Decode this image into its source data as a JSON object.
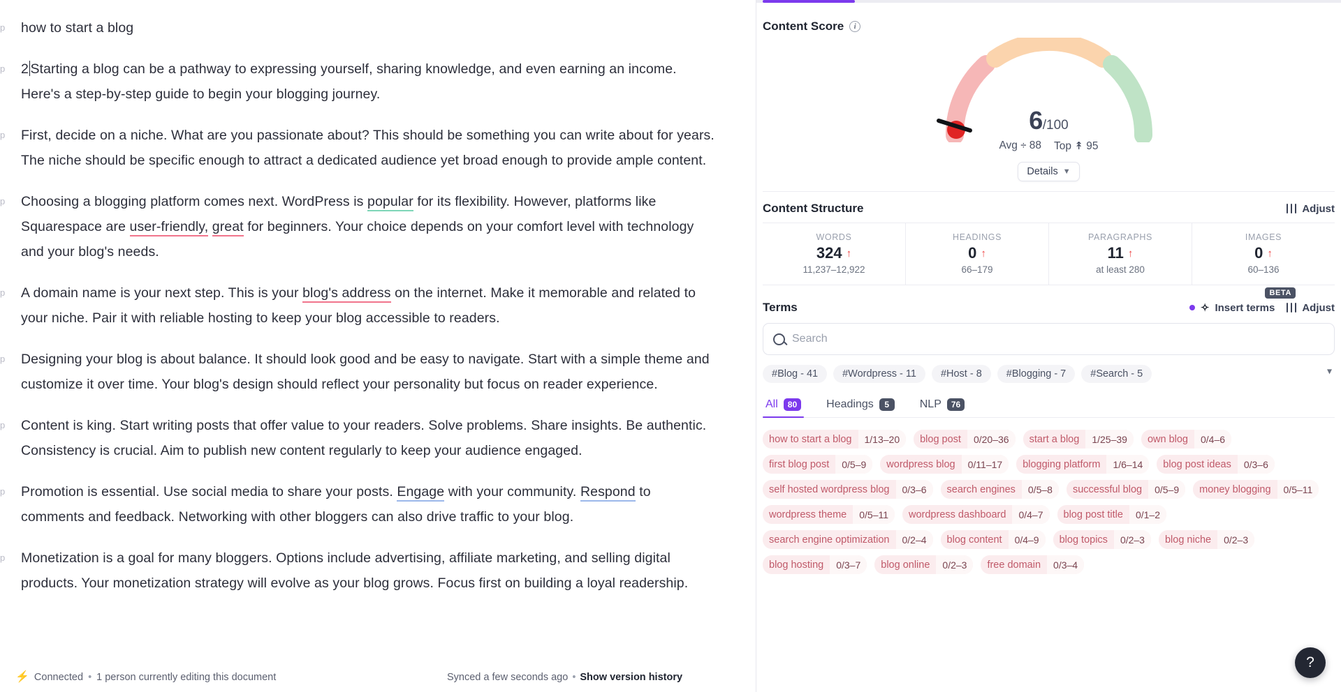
{
  "editor": {
    "paragraph_tag": "p",
    "paragraphs": [
      {
        "tag": "p",
        "text": "how to start a blog"
      },
      {
        "tag": "p",
        "text": "2Starting a blog can be a pathway to expressing yourself, sharing knowledge, and even earning an income. Here's a step-by-step guide to begin your blogging journey."
      },
      {
        "tag": "p",
        "text": "First, decide on a niche. What are you passionate about? This should be something you can write about for years. The niche should be specific enough to attract a dedicated audience yet broad enough to provide ample content."
      },
      {
        "tag": "p",
        "text": "Choosing a blogging platform comes next. WordPress is popular for its flexibility. However, platforms like Squarespace are user-friendly, great for beginners. Your choice depends on your comfort level with technology and your blog's needs."
      },
      {
        "tag": "p",
        "text": "A domain name is your next step. This is your blog's address on the internet. Make it memorable and related to your niche. Pair it with reliable hosting to keep your blog accessible to readers."
      },
      {
        "tag": "p",
        "text": "Designing your blog is about balance. It should look good and be easy to navigate. Start with a simple theme and customize it over time. Your blog's design should reflect your personality but focus on reader experience."
      },
      {
        "tag": "p",
        "text": "Content is king. Start writing posts that offer value to your readers. Solve problems. Share insights. Be authentic. Consistency is crucial. Aim to publish new content regularly to keep your audience engaged."
      },
      {
        "tag": "p",
        "text": "Promotion is essential. Use social media to share your posts. Engage with your community. Respond to comments and feedback. Networking with other bloggers can also drive traffic to your blog."
      },
      {
        "tag": "p",
        "text": "Monetization is a goal for many bloggers. Options include advertising, affiliate marketing, and selling digital products. Your monetization strategy will evolve as your blog grows. Focus first on building a loyal readership."
      }
    ],
    "highlights": {
      "popular": "#7fd6b8",
      "user-friendly,": "#f1748c",
      "great": "#f1748c",
      "blog's address": "#f1748c",
      "Engage": "#9cb8ea",
      "Respond": "#9cb8ea"
    }
  },
  "status_bar": {
    "bolt_icon": "bolt-icon",
    "connection": "Connected",
    "separator": "•",
    "editors": "1 person currently editing this document",
    "synced": "Synced a few seconds ago",
    "version_link": "Show version history"
  },
  "content_score": {
    "title": "Content Score",
    "info_icon": "info-icon",
    "score": "6",
    "denominator": "/100",
    "avg_label": "Avg",
    "avg_icon": "divide-icon",
    "avg_value": "88",
    "top_label": "Top",
    "top_icon": "up-arrow-bar-icon",
    "top_value": "95",
    "details_label": "Details",
    "details_chevron": "chevron-down-icon"
  },
  "content_structure": {
    "title": "Content Structure",
    "adjust_label": "Adjust",
    "adjust_icon": "sliders-icon",
    "stats": [
      {
        "key": "WORDS",
        "value": "324",
        "trend": "↑",
        "range": "11,237–12,922"
      },
      {
        "key": "HEADINGS",
        "value": "0",
        "trend": "↑",
        "range": "66–179"
      },
      {
        "key": "PARAGRAPHS",
        "value": "11",
        "trend": "↑",
        "range": "at least 280"
      },
      {
        "key": "IMAGES",
        "value": "0",
        "trend": "↑",
        "range": "60–136"
      }
    ]
  },
  "terms": {
    "title": "Terms",
    "beta_badge": "BETA",
    "insert_terms_label": "Insert terms",
    "insert_icon": "sparkle-icon",
    "adjust_label": "Adjust",
    "adjust_icon": "sliders-icon",
    "search_placeholder": "Search",
    "search_value": "",
    "search_icon": "search-icon",
    "expand_chevron": "chevron-down-icon",
    "hashtags": [
      "#Blog - 41",
      "#Wordpress - 11",
      "#Host - 8",
      "#Blogging - 7",
      "#Search - 5"
    ],
    "tabs": [
      {
        "label": "All",
        "count": "80",
        "active": true
      },
      {
        "label": "Headings",
        "count": "5",
        "active": false
      },
      {
        "label": "NLP",
        "count": "76",
        "active": false
      }
    ],
    "items": [
      {
        "name": "how to start a blog",
        "count": "1/13–20"
      },
      {
        "name": "blog post",
        "count": "0/20–36"
      },
      {
        "name": "start a blog",
        "count": "1/25–39"
      },
      {
        "name": "own blog",
        "count": "0/4–6"
      },
      {
        "name": "first blog post",
        "count": "0/5–9"
      },
      {
        "name": "wordpress blog",
        "count": "0/11–17"
      },
      {
        "name": "blogging platform",
        "count": "1/6–14"
      },
      {
        "name": "blog post ideas",
        "count": "0/3–6"
      },
      {
        "name": "self hosted wordpress blog",
        "count": "0/3–6"
      },
      {
        "name": "search engines",
        "count": "0/5–8"
      },
      {
        "name": "successful blog",
        "count": "0/5–9"
      },
      {
        "name": "money blogging",
        "count": "0/5–11"
      },
      {
        "name": "wordpress theme",
        "count": "0/5–11"
      },
      {
        "name": "wordpress dashboard",
        "count": "0/4–7"
      },
      {
        "name": "blog post title",
        "count": "0/1–2"
      },
      {
        "name": "search engine optimization",
        "count": "0/2–4"
      },
      {
        "name": "blog content",
        "count": "0/4–9"
      },
      {
        "name": "blog topics",
        "count": "0/2–3"
      },
      {
        "name": "blog niche",
        "count": "0/2–3"
      },
      {
        "name": "blog hosting",
        "count": "0/3–7"
      },
      {
        "name": "blog online",
        "count": "0/2–3"
      },
      {
        "name": "free domain",
        "count": "0/3–4"
      }
    ]
  },
  "help": {
    "label": "?",
    "icon": "question-mark-icon"
  },
  "colors": {
    "accent_purple": "#7c3aed",
    "danger_red": "#ef4444",
    "term_bg": "#fbecee",
    "term_text": "#c05a6a",
    "gauge_red": "#f6b7b7",
    "gauge_orange": "#fbd4ad",
    "gauge_green": "#bfe3c6",
    "needle_red": "#e02424",
    "connected_green": "#3fc78f"
  }
}
